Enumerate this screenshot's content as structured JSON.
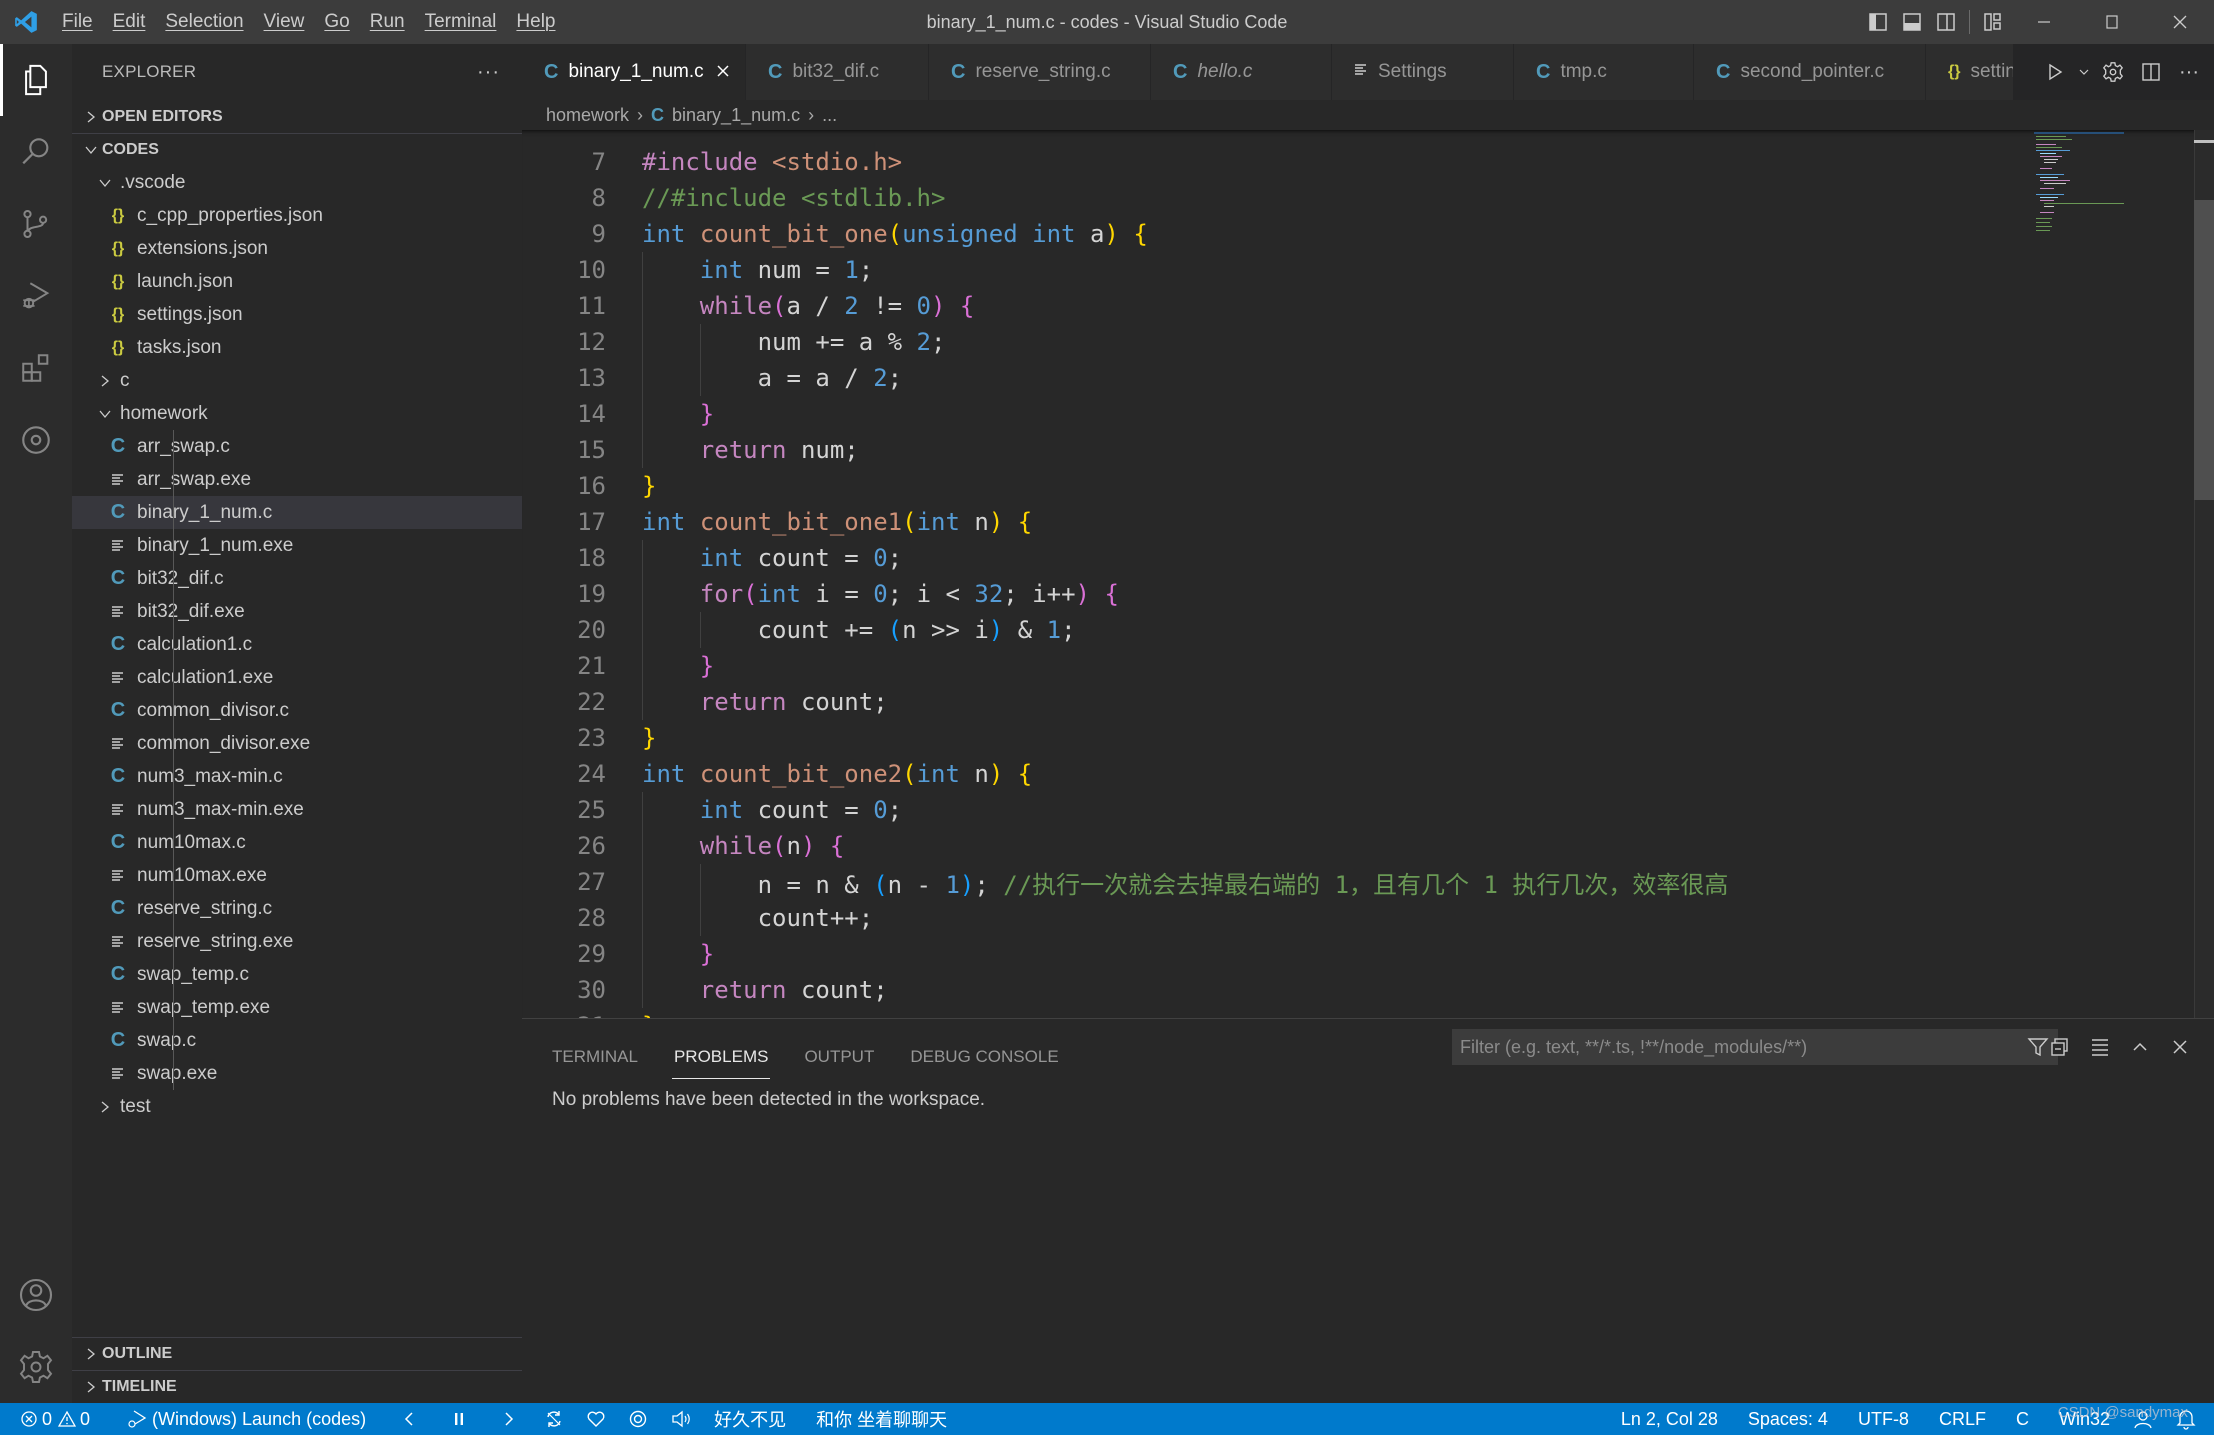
{
  "window": {
    "title": "binary_1_num.c - codes - Visual Studio Code",
    "menu": [
      "File",
      "Edit",
      "Selection",
      "View",
      "Go",
      "Run",
      "Terminal",
      "Help"
    ]
  },
  "sidebar": {
    "title": "EXPLORER",
    "more": "···",
    "open_editors": "OPEN EDITORS",
    "workspace": "CODES",
    "tree": [
      {
        "label": ".vscode",
        "type": "folder-open",
        "depth": 1
      },
      {
        "label": "c_cpp_properties.json",
        "type": "json",
        "depth": 2
      },
      {
        "label": "extensions.json",
        "type": "json",
        "depth": 2
      },
      {
        "label": "launch.json",
        "type": "json",
        "depth": 2
      },
      {
        "label": "settings.json",
        "type": "json",
        "depth": 2
      },
      {
        "label": "tasks.json",
        "type": "json",
        "depth": 2
      },
      {
        "label": "c",
        "type": "folder-closed",
        "depth": 1
      },
      {
        "label": "homework",
        "type": "folder-open",
        "depth": 1
      },
      {
        "label": "arr_swap.c",
        "type": "c",
        "depth": 2
      },
      {
        "label": "arr_swap.exe",
        "type": "exe",
        "depth": 2
      },
      {
        "label": "binary_1_num.c",
        "type": "c",
        "depth": 2,
        "selected": true
      },
      {
        "label": "binary_1_num.exe",
        "type": "exe",
        "depth": 2
      },
      {
        "label": "bit32_dif.c",
        "type": "c",
        "depth": 2
      },
      {
        "label": "bit32_dif.exe",
        "type": "exe",
        "depth": 2
      },
      {
        "label": "calculation1.c",
        "type": "c",
        "depth": 2
      },
      {
        "label": "calculation1.exe",
        "type": "exe",
        "depth": 2
      },
      {
        "label": "common_divisor.c",
        "type": "c",
        "depth": 2
      },
      {
        "label": "common_divisor.exe",
        "type": "exe",
        "depth": 2
      },
      {
        "label": "num3_max-min.c",
        "type": "c",
        "depth": 2
      },
      {
        "label": "num3_max-min.exe",
        "type": "exe",
        "depth": 2
      },
      {
        "label": "num10max.c",
        "type": "c",
        "depth": 2
      },
      {
        "label": "num10max.exe",
        "type": "exe",
        "depth": 2
      },
      {
        "label": "reserve_string.c",
        "type": "c",
        "depth": 2
      },
      {
        "label": "reserve_string.exe",
        "type": "exe",
        "depth": 2
      },
      {
        "label": "swap_temp.c",
        "type": "c",
        "depth": 2
      },
      {
        "label": "swap_temp.exe",
        "type": "exe",
        "depth": 2
      },
      {
        "label": "swap.c",
        "type": "c",
        "depth": 2
      },
      {
        "label": "swap.exe",
        "type": "exe",
        "depth": 2
      },
      {
        "label": "test",
        "type": "folder-closed",
        "depth": 1
      }
    ],
    "outline": "OUTLINE",
    "timeline": "TIMELINE"
  },
  "tabs": [
    {
      "label": "binary_1_num.c",
      "icon": "c",
      "active": true,
      "closable": true
    },
    {
      "label": "bit32_dif.c",
      "icon": "c"
    },
    {
      "label": "reserve_string.c",
      "icon": "c"
    },
    {
      "label": "hello.c",
      "icon": "c",
      "italic": true
    },
    {
      "label": "Settings",
      "icon": "settings"
    },
    {
      "label": "tmp.c",
      "icon": "c"
    },
    {
      "label": "second_pointer.c",
      "icon": "c"
    },
    {
      "label": "settin",
      "icon": "json"
    }
  ],
  "breadcrumb": {
    "folder": "homework",
    "file": "binary_1_num.c",
    "more": "..."
  },
  "editor": {
    "lines": [
      {
        "n": 7,
        "indent": 0,
        "tokens": [
          [
            "pp",
            "#include"
          ],
          [
            "",
            " "
          ],
          [
            "str",
            "<stdio.h>"
          ]
        ]
      },
      {
        "n": 8,
        "indent": 0,
        "tokens": [
          [
            "cm",
            "//#include <stdlib.h>"
          ]
        ]
      },
      {
        "n": 9,
        "indent": 0,
        "tokens": [
          [
            "kw",
            "int"
          ],
          [
            "",
            " "
          ],
          [
            "fn",
            "count_bit_one"
          ],
          [
            "b1",
            "("
          ],
          [
            "kw",
            "unsigned int"
          ],
          [
            "",
            " a"
          ],
          [
            "b1",
            ")"
          ],
          [
            "",
            " "
          ],
          [
            "b1",
            "{"
          ]
        ]
      },
      {
        "n": 10,
        "indent": 1,
        "tokens": [
          [
            "kw",
            "int"
          ],
          [
            "",
            " num = "
          ],
          [
            "num",
            "1"
          ],
          [
            "",
            ";"
          ]
        ]
      },
      {
        "n": 11,
        "indent": 1,
        "tokens": [
          [
            "ctl",
            "while"
          ],
          [
            "b2",
            "("
          ],
          [
            "",
            "a / "
          ],
          [
            "num",
            "2"
          ],
          [
            "",
            " != "
          ],
          [
            "num",
            "0"
          ],
          [
            "b2",
            ")"
          ],
          [
            "",
            " "
          ],
          [
            "b2",
            "{"
          ]
        ]
      },
      {
        "n": 12,
        "indent": 2,
        "tokens": [
          [
            "",
            "num += a % "
          ],
          [
            "num",
            "2"
          ],
          [
            "",
            ";"
          ]
        ]
      },
      {
        "n": 13,
        "indent": 2,
        "tokens": [
          [
            "",
            "a = a / "
          ],
          [
            "num",
            "2"
          ],
          [
            "",
            ";"
          ]
        ]
      },
      {
        "n": 14,
        "indent": 1,
        "tokens": [
          [
            "b2",
            "}"
          ]
        ]
      },
      {
        "n": 15,
        "indent": 1,
        "tokens": [
          [
            "ctl",
            "return"
          ],
          [
            "",
            " num;"
          ]
        ]
      },
      {
        "n": 16,
        "indent": 0,
        "tokens": [
          [
            "b1",
            "}"
          ]
        ]
      },
      {
        "n": 17,
        "indent": 0,
        "tokens": [
          [
            "kw",
            "int"
          ],
          [
            "",
            " "
          ],
          [
            "fn",
            "count_bit_one1"
          ],
          [
            "b1",
            "("
          ],
          [
            "kw",
            "int"
          ],
          [
            "",
            " n"
          ],
          [
            "b1",
            ")"
          ],
          [
            "",
            " "
          ],
          [
            "b1",
            "{"
          ]
        ]
      },
      {
        "n": 18,
        "indent": 1,
        "tokens": [
          [
            "kw",
            "int"
          ],
          [
            "",
            " count = "
          ],
          [
            "num",
            "0"
          ],
          [
            "",
            ";"
          ]
        ]
      },
      {
        "n": 19,
        "indent": 1,
        "tokens": [
          [
            "ctl",
            "for"
          ],
          [
            "b2",
            "("
          ],
          [
            "kw",
            "int"
          ],
          [
            "",
            " i = "
          ],
          [
            "num",
            "0"
          ],
          [
            "",
            "; i < "
          ],
          [
            "num",
            "32"
          ],
          [
            "",
            "; i++"
          ],
          [
            "b2",
            ")"
          ],
          [
            "",
            " "
          ],
          [
            "b2",
            "{"
          ]
        ]
      },
      {
        "n": 20,
        "indent": 2,
        "tokens": [
          [
            "",
            "count += "
          ],
          [
            "b3",
            "("
          ],
          [
            "",
            "n >> i"
          ],
          [
            "b3",
            ")"
          ],
          [
            "",
            " & "
          ],
          [
            "num",
            "1"
          ],
          [
            "",
            ";"
          ]
        ]
      },
      {
        "n": 21,
        "indent": 1,
        "tokens": [
          [
            "b2",
            "}"
          ]
        ]
      },
      {
        "n": 22,
        "indent": 1,
        "tokens": [
          [
            "ctl",
            "return"
          ],
          [
            "",
            " count;"
          ]
        ]
      },
      {
        "n": 23,
        "indent": 0,
        "tokens": [
          [
            "b1",
            "}"
          ]
        ]
      },
      {
        "n": 24,
        "indent": 0,
        "tokens": [
          [
            "kw",
            "int"
          ],
          [
            "",
            " "
          ],
          [
            "fn",
            "count_bit_one2"
          ],
          [
            "b1",
            "("
          ],
          [
            "kw",
            "int"
          ],
          [
            "",
            " n"
          ],
          [
            "b1",
            ")"
          ],
          [
            "",
            " "
          ],
          [
            "b1",
            "{"
          ]
        ]
      },
      {
        "n": 25,
        "indent": 1,
        "tokens": [
          [
            "kw",
            "int"
          ],
          [
            "",
            " count = "
          ],
          [
            "num",
            "0"
          ],
          [
            "",
            ";"
          ]
        ]
      },
      {
        "n": 26,
        "indent": 1,
        "tokens": [
          [
            "ctl",
            "while"
          ],
          [
            "b2",
            "("
          ],
          [
            "",
            "n"
          ],
          [
            "b2",
            ")"
          ],
          [
            "",
            " "
          ],
          [
            "b2",
            "{"
          ]
        ]
      },
      {
        "n": 27,
        "indent": 2,
        "tokens": [
          [
            "",
            "n = n & "
          ],
          [
            "b3",
            "("
          ],
          [
            "",
            "n - "
          ],
          [
            "num",
            "1"
          ],
          [
            "b3",
            ")"
          ],
          [
            "",
            "; "
          ],
          [
            "cm",
            "//执行一次就会去掉最右端的 1，且有几个 1 执行几次，效率很高"
          ]
        ]
      },
      {
        "n": 28,
        "indent": 2,
        "tokens": [
          [
            "",
            "count++;"
          ]
        ]
      },
      {
        "n": 29,
        "indent": 1,
        "tokens": [
          [
            "b2",
            "}"
          ]
        ]
      },
      {
        "n": 30,
        "indent": 1,
        "tokens": [
          [
            "ctl",
            "return"
          ],
          [
            "",
            " count;"
          ]
        ]
      }
    ]
  },
  "panel": {
    "tabs": [
      "TERMINAL",
      "PROBLEMS",
      "OUTPUT",
      "DEBUG CONSOLE"
    ],
    "active_tab": "PROBLEMS",
    "message": "No problems have been detected in the workspace.",
    "filter_placeholder": "Filter (e.g. text, **/*.ts, !**/node_modules/**)",
    "filter_value": ""
  },
  "statusbar": {
    "errors": "0",
    "warnings": "0",
    "debug_config": "(Windows) Launch (codes)",
    "music_song": "好久不见",
    "music_lyric": "和你 坐着聊聊天",
    "cursor": "Ln 2, Col 28",
    "indent": "Spaces: 4",
    "encoding": "UTF-8",
    "eol": "CRLF",
    "language": "C",
    "platform": "Win32"
  },
  "watermark": "CSDN @sandymax",
  "colors": {
    "statusbar": "#007acc",
    "accent_c": "#519aba",
    "accent_json": "#cbcb41"
  }
}
